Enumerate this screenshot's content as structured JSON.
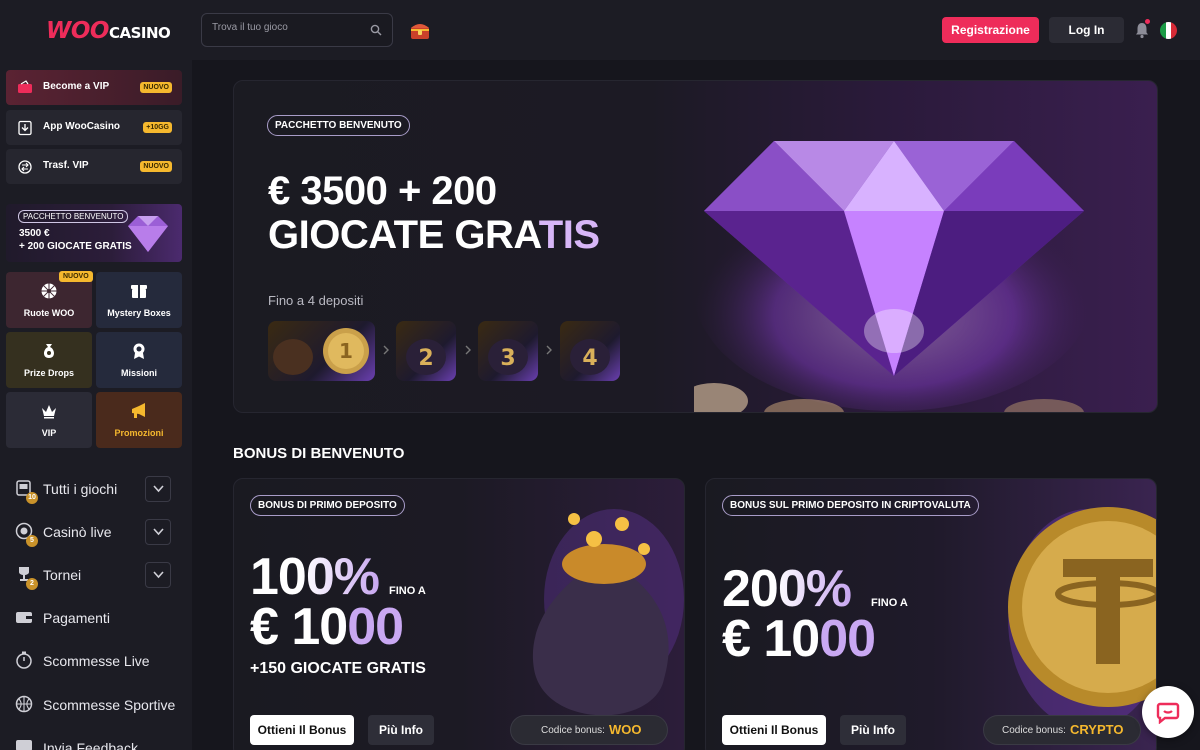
{
  "header": {
    "logo_woo": "WOO",
    "logo_casino": "CASINO",
    "search_placeholder": "Trova il tuo gioco",
    "register_label": "Registrazione",
    "login_label": "Log In"
  },
  "sidebar": {
    "promos": [
      {
        "label": "Become a VIP",
        "badge": "NUOVO"
      },
      {
        "label": "App WooCasino",
        "badge": "+10GG"
      },
      {
        "label": "Trasf. VIP",
        "badge": "NUOVO"
      }
    ],
    "banner": {
      "tag": "PACCHETTO BENVENUTO",
      "line1": "3500 €",
      "line2": "+ 200 GIOCATE GRATIS"
    },
    "tiles": [
      {
        "label": "Ruote WOO",
        "badge": "NUOVO"
      },
      {
        "label": "Mystery Boxes"
      },
      {
        "label": "Prize Drops"
      },
      {
        "label": "Missioni"
      },
      {
        "label": "VIP"
      },
      {
        "label": "Promozioni"
      }
    ],
    "nav": [
      {
        "label": "Tutti i giochi",
        "count": "10"
      },
      {
        "label": "Casinò live",
        "count": "5"
      },
      {
        "label": "Tornei",
        "count": "2"
      },
      {
        "label": "Pagamenti"
      },
      {
        "label": "Scommesse Live"
      },
      {
        "label": "Scommesse Sportive"
      },
      {
        "label": "Invia Feedback"
      }
    ]
  },
  "hero": {
    "tag": "PACCHETTO BENVENUTO",
    "line1": "€ 3500 + 200",
    "line2_a": "GIOCATE GRA",
    "line2_b": "TIS",
    "sub": "Fino a 4 depositi",
    "steps": [
      "1",
      "2",
      "3",
      "4"
    ]
  },
  "section": {
    "title": "BONUS DI BENVENUTO",
    "cards": [
      {
        "tag": "BONUS DI PRIMO DEPOSITO",
        "pct": "100%",
        "fino": "FINO A",
        "amount_a": "€ 10",
        "amount_b": "00",
        "extra": "+150 GIOCATE GRATIS",
        "btn_get": "Ottieni Il Bonus",
        "btn_info": "Più Info",
        "code_label": "Codice bonus:",
        "code_value": "WOO"
      },
      {
        "tag": "BONUS SUL PRIMO DEPOSITO IN CRIPTOVALUTA",
        "pct": "200%",
        "fino": "FINO A",
        "amount_a": "€ 10",
        "amount_b": "00",
        "btn_get": "Ottieni Il Bonus",
        "btn_info": "Più Info",
        "code_label": "Codice bonus:",
        "code_value": "CRYPTO"
      }
    ]
  },
  "colors": {
    "accent": "#ee2c5a",
    "gold": "#f5b82e",
    "purple": "#c9a8f2",
    "bg": "#16161d"
  }
}
